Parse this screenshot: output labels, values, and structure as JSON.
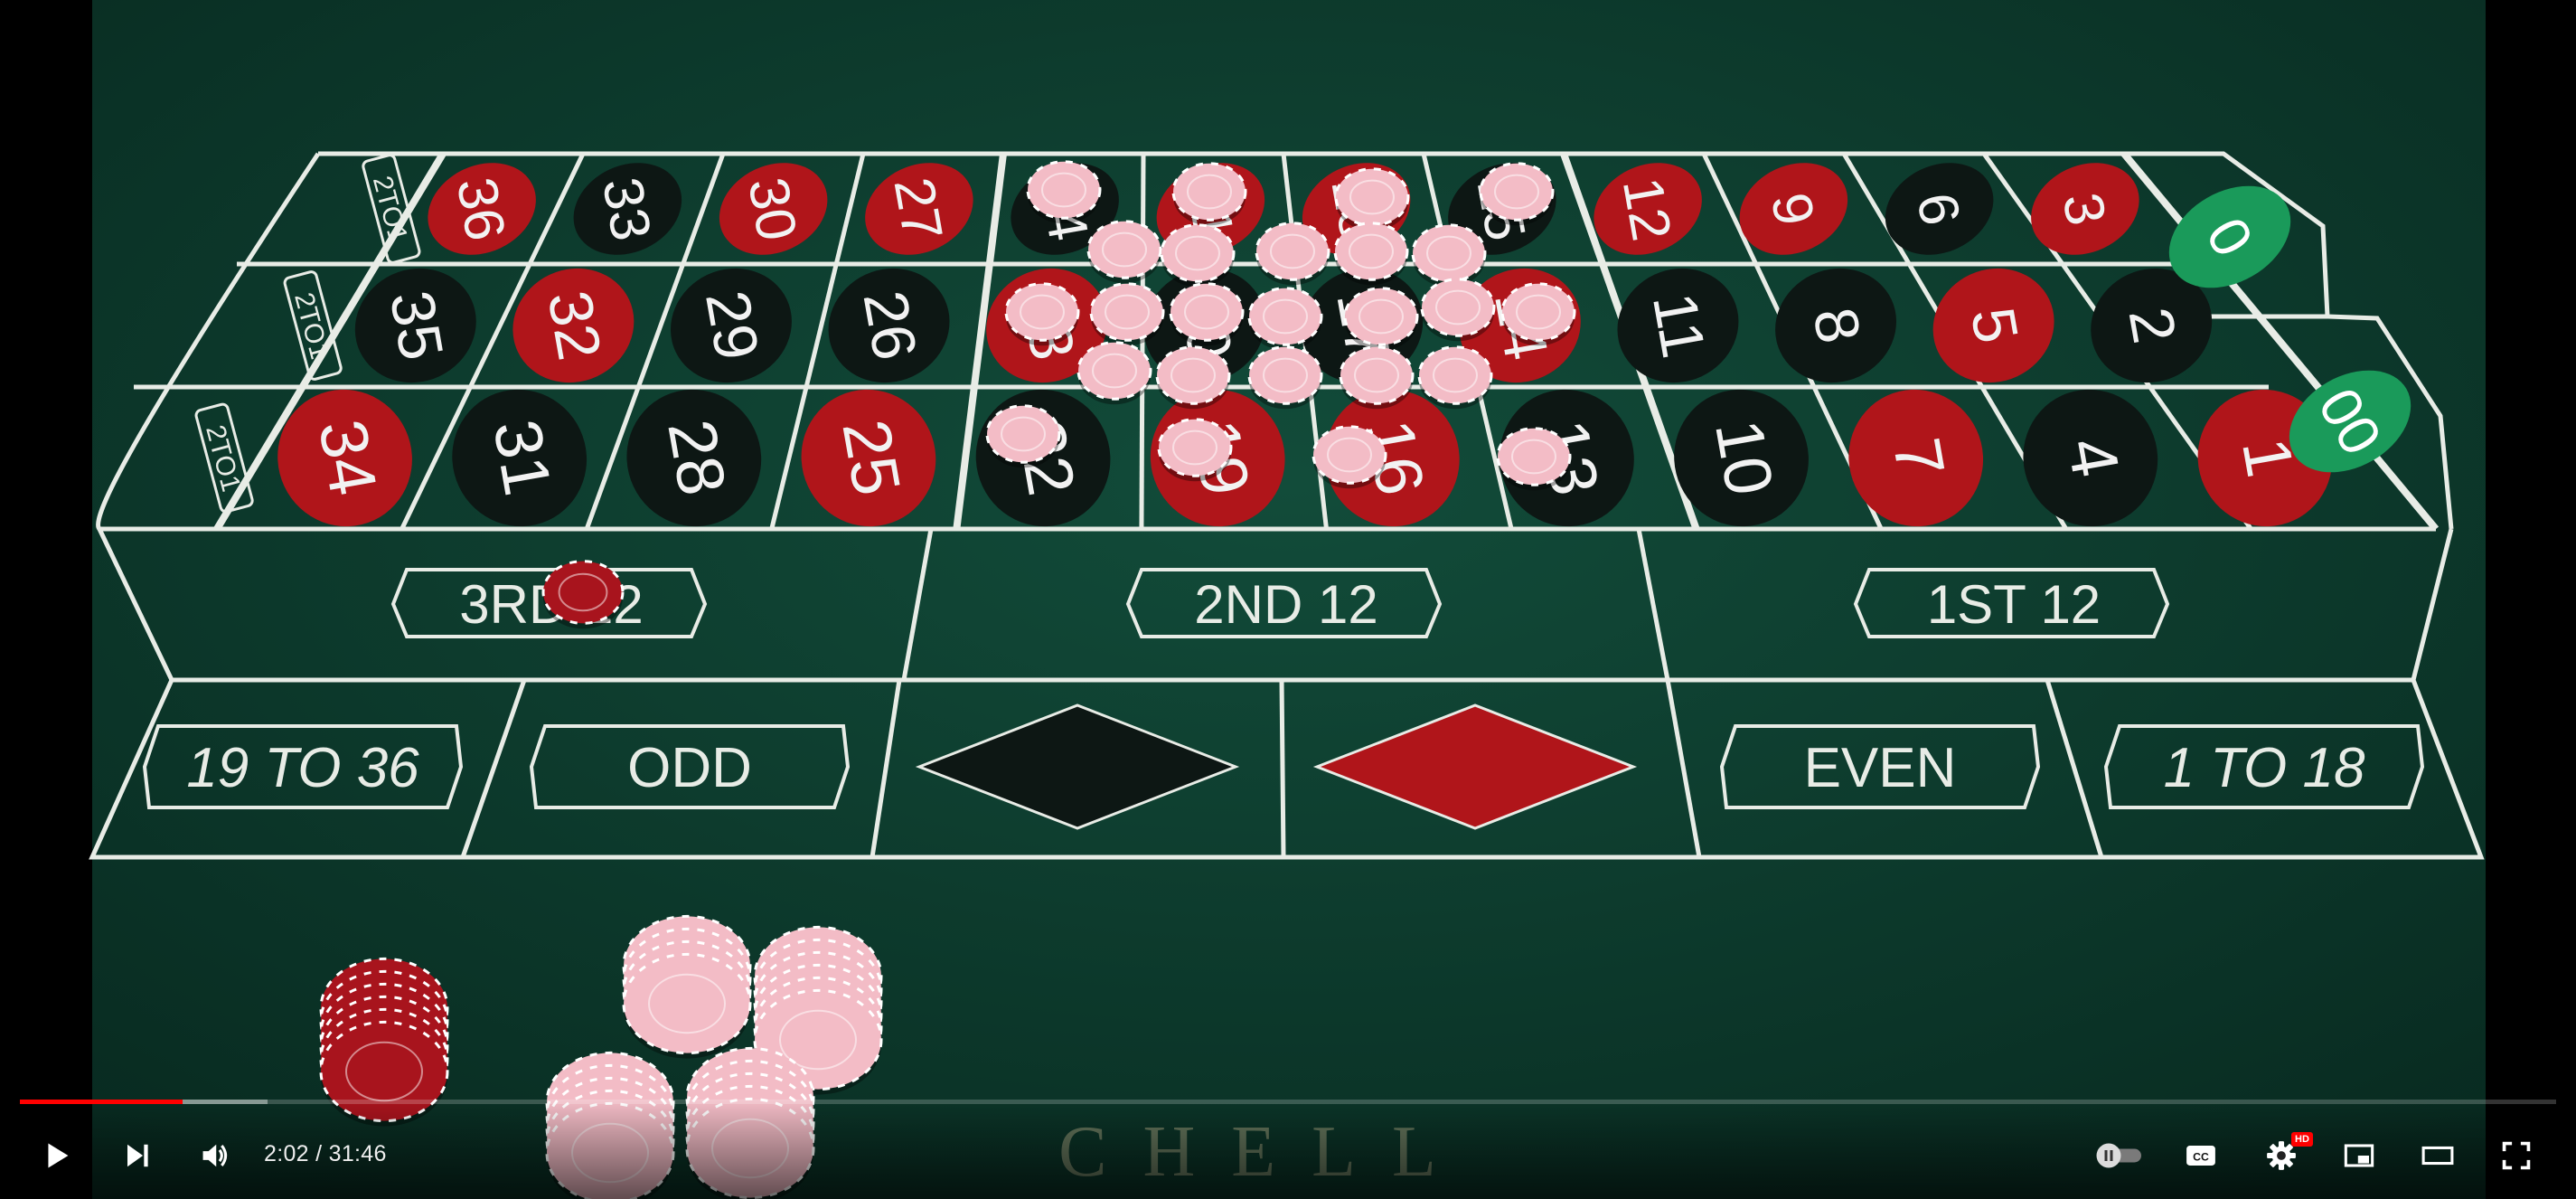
{
  "colors": {
    "felt": "#0e3f30",
    "red_pocket": "#b0151a",
    "black_pocket": "#0d1714",
    "green_pocket": "#1a9a5a",
    "line": "#e8ece6",
    "chip_pink": "#f3bcc6",
    "chip_red": "#a8141d",
    "progress_red": "#ff0000"
  },
  "table": {
    "rows": [
      {
        "col_label": "2TO1",
        "numbers": [
          "36",
          "33",
          "30",
          "27",
          "24",
          "21",
          "18",
          "15",
          "12",
          "9",
          "6",
          "3"
        ]
      },
      {
        "col_label": "2TO1",
        "numbers": [
          "35",
          "32",
          "29",
          "26",
          "23",
          "20",
          "17",
          "14",
          "11",
          "8",
          "5",
          "2"
        ]
      },
      {
        "col_label": "2TO1",
        "numbers": [
          "34",
          "31",
          "28",
          "25",
          "22",
          "19",
          "16",
          "13",
          "10",
          "7",
          "4",
          "1"
        ]
      }
    ],
    "red_numbers": [
      "36",
      "30",
      "27",
      "21",
      "18",
      "12",
      "9",
      "3",
      "32",
      "23",
      "14",
      "5",
      "34",
      "25",
      "19",
      "16",
      "7",
      "1"
    ],
    "zeros": [
      "0",
      "00"
    ],
    "dozens": [
      "3RD 12",
      "2ND 12",
      "1ST 12"
    ],
    "outside": [
      "19 TO 36",
      "ODD",
      "black",
      "red",
      "EVEN",
      "1 TO 18"
    ],
    "bottom_text": "CHELL"
  },
  "player": {
    "time_current": "2:02",
    "time_separator": " / ",
    "time_total": "31:46",
    "progress_fraction": 0.064,
    "buffer_fraction": 0.0975,
    "hd_badge": "HD",
    "icons": {
      "play": "play-icon",
      "next": "next-icon",
      "volume": "volume-icon",
      "autoplay": "autoplay-toggle-icon",
      "captions": "cc-icon",
      "settings": "gear-icon",
      "miniplayer": "miniplayer-icon",
      "theater": "theater-icon",
      "fullscreen": "fullscreen-icon"
    }
  }
}
